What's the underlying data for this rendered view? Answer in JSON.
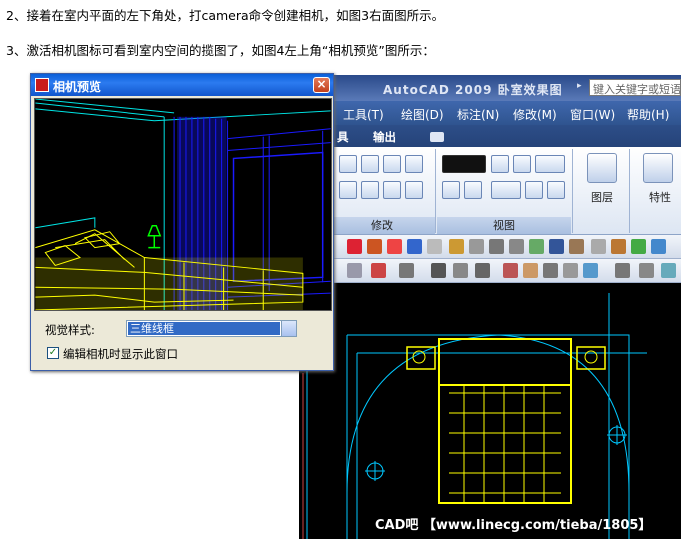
{
  "instructions": {
    "line1": "2、接着在室内平面的左下角处，打camera命令创建相机，如图3右面图所示。",
    "line2": "3、激活相机图标可看到室内空间的揽图了，如图4左上角“相机预览”图所示："
  },
  "acad": {
    "title": "AutoCAD 2009  卧室效果图",
    "search_placeholder": "键入关键字或短语",
    "menu": [
      "工具(T)",
      "绘图(D)",
      "标注(N)",
      "修改(M)",
      "窗口(W)",
      "帮助(H)"
    ],
    "tabs": [
      "具",
      "输出"
    ],
    "panels": {
      "modify": "修改",
      "view": "视图"
    },
    "buttons": {
      "layers": "图层",
      "properties": "特性"
    }
  },
  "dialog": {
    "title": "相机预览",
    "close_glyph": "×",
    "visual_style_label": "视觉样式:",
    "visual_style_value": "三维线框",
    "checkbox_checked_glyph": "✓",
    "checkbox_label": "编辑相机时显示此窗口"
  },
  "watermark": "CAD吧 【www.linecg.com/tieba/1805】",
  "colors": {
    "dialog_title": "#1155cc",
    "acad_title": "#2a4a8a",
    "wire_yellow": "#ffff00",
    "wire_blue": "#1a1aff",
    "wire_cyan": "#00e5e5",
    "wire_green": "#00ff00",
    "selection": "#316ac5"
  }
}
